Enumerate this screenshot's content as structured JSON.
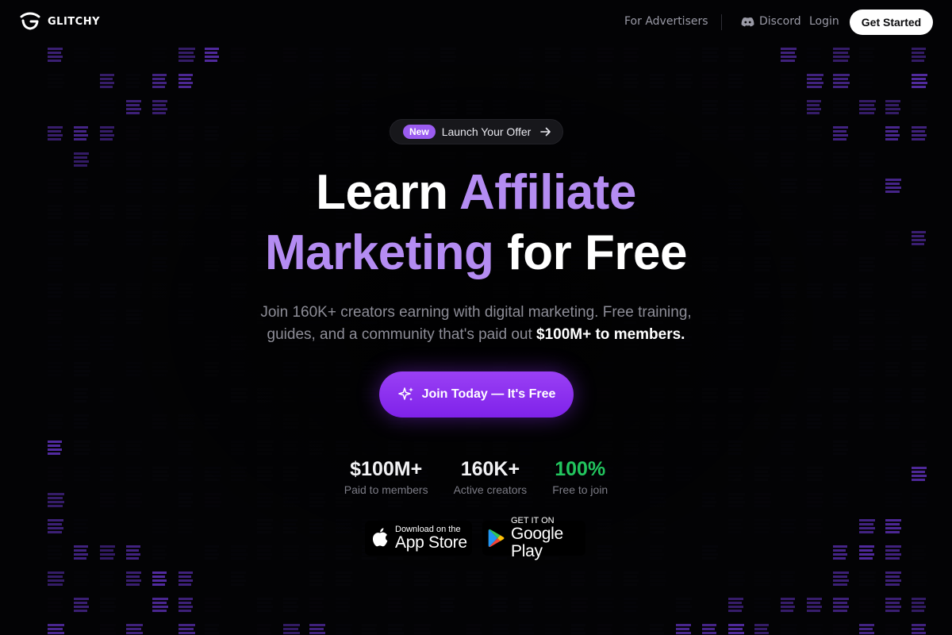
{
  "brand": {
    "name": "GLITCHY"
  },
  "nav": {
    "advertisers": "For Advertisers",
    "discord": "Discord",
    "login": "Login",
    "get_started": "Get Started"
  },
  "announcement": {
    "badge": "New",
    "text": "Launch Your Offer"
  },
  "hero": {
    "line1_white": "Learn",
    "line1_purple": "Affiliate",
    "line2_purple": "Marketing",
    "line2_white": "for Free",
    "subtext": "Join 160K+ creators earning with digital marketing. Free training, guides, and a community that's paid out",
    "subtext_highlight": "$100M+ to members."
  },
  "cta": {
    "label": "Join Today — It's Free"
  },
  "stats": [
    {
      "value": "$100M+",
      "label": "Paid to members"
    },
    {
      "value": "160K+",
      "label": "Active creators"
    },
    {
      "value": "100%",
      "label": "Free to join"
    }
  ],
  "stores": {
    "apple_small": "Download on the",
    "apple_big": "App Store",
    "google_small": "GET IT ON",
    "google_big": "Google Play"
  },
  "colors": {
    "accent": "#9b5cf0",
    "headline_purple": "#b48cf2",
    "cta_start": "#9a40f4",
    "cta_end": "#7f22ea",
    "stat_green": "#22c55e",
    "background": "#030305"
  },
  "icons": [
    "glitchy-logo-icon",
    "discord-icon",
    "arrow-right-icon",
    "sparkle-icon",
    "apple-icon",
    "google-play-icon"
  ]
}
